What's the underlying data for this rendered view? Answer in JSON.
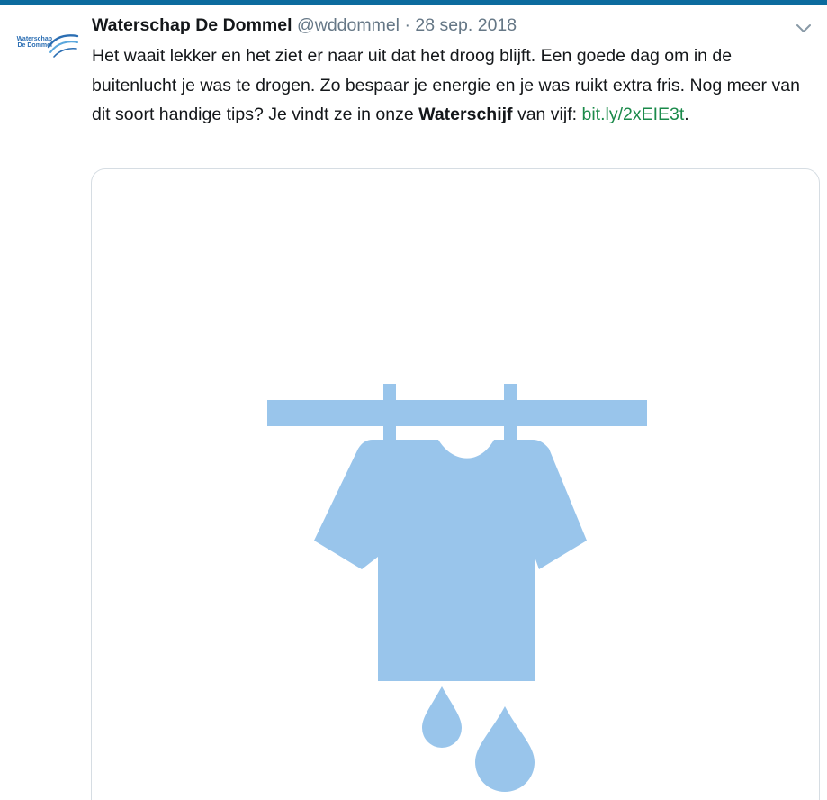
{
  "tweet": {
    "author": {
      "name": "Waterschap De Dommel",
      "handle": "@wddommel",
      "avatar_text_line1": "Waterschap",
      "avatar_text_line2": "De Dommel"
    },
    "separator": "·",
    "date": "28 sep. 2018",
    "text": {
      "part1": "Het waait lekker en het ziet er naar uit dat het droog blijft.  Een goede dag om in de buitenlucht je was te drogen. Zo bespaar je energie en je was ruikt extra fris. Nog meer van dit soort handige tips? Je vindt ze in onze ",
      "bold_word": "Waterschijf",
      "part2": " van vijf: ",
      "link": "bit.ly/2xEIE3t",
      "end": "."
    },
    "icons": {
      "more_options": "chevron-down-icon",
      "media": "tshirt-on-clothesline-icon"
    }
  },
  "colors": {
    "top_bar": "#0c6b9e",
    "name": "#14171a",
    "muted": "#657786",
    "link": "#1a8a4a",
    "illustration": "#99c5eb",
    "card_border": "#d6dde3"
  }
}
